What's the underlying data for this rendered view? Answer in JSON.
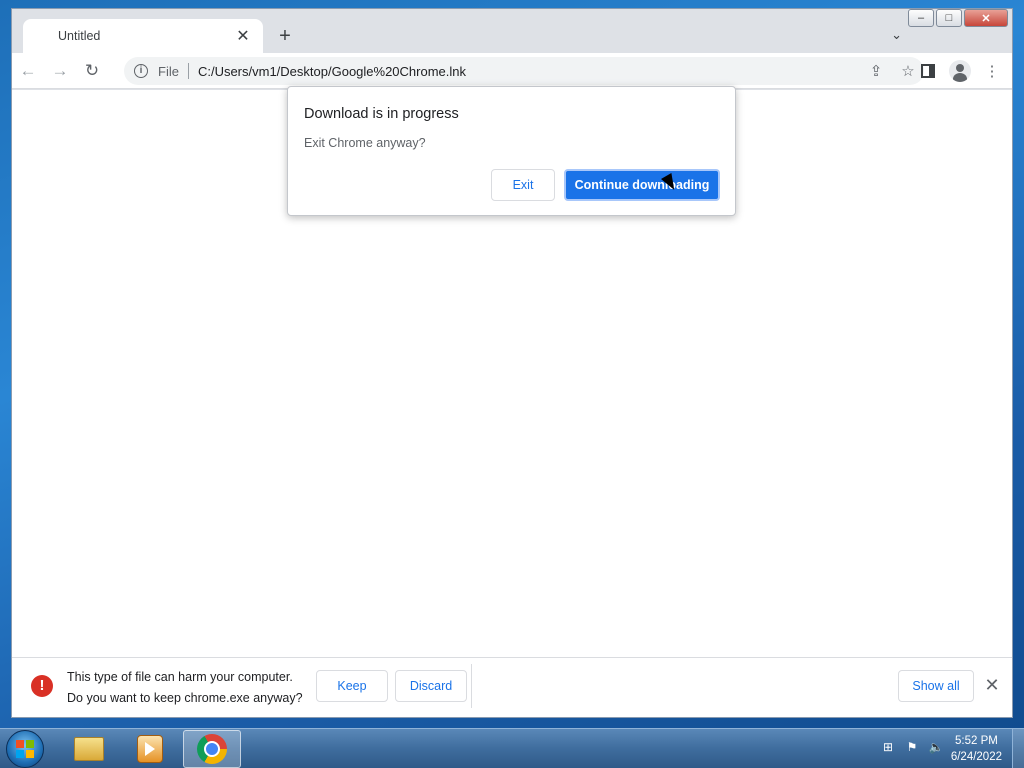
{
  "browser": {
    "tab_title": "Untitled",
    "url_scheme": "File",
    "url": "C:/Users/vm1/Desktop/Google%20Chrome.lnk"
  },
  "dialog": {
    "title": "Download is in progress",
    "message": "Exit Chrome anyway?",
    "exit_label": "Exit",
    "continue_label": "Continue downloading"
  },
  "download_shelf": {
    "warning_line1": "This type of file can harm your computer.",
    "warning_line2": "Do you want to keep chrome.exe anyway?",
    "keep_label": "Keep",
    "discard_label": "Discard",
    "show_all_label": "Show all"
  },
  "taskbar": {
    "time": "5:52 PM",
    "date": "6/24/2022"
  },
  "colors": {
    "accent": "#1a73e8",
    "danger": "#d93025"
  }
}
